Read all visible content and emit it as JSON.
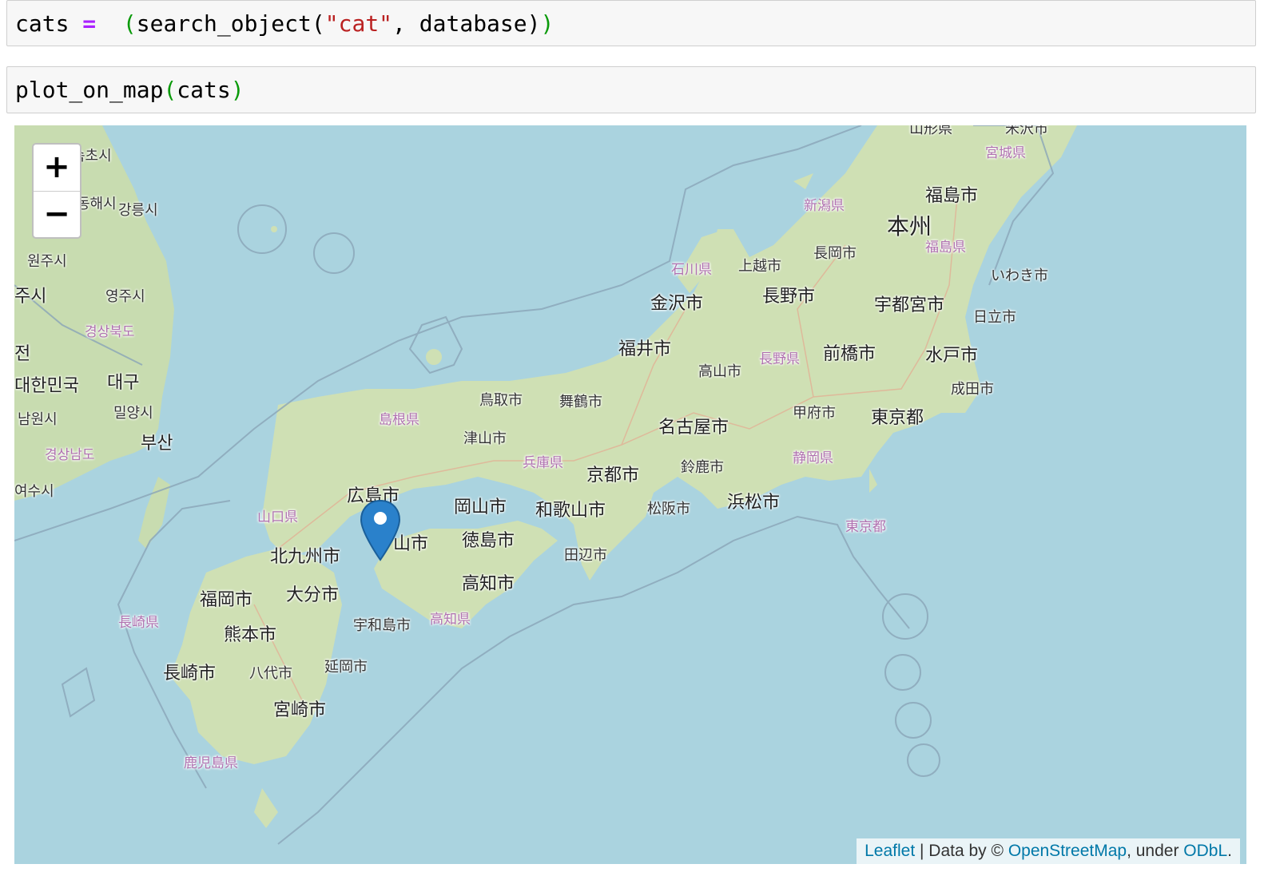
{
  "cells": [
    {
      "code": {
        "var": "cats",
        "op": "=",
        "open": "(",
        "func": "search_object(",
        "str": "\"cat\"",
        "rest": ", database)",
        "close": ")"
      }
    },
    {
      "code": {
        "func": "plot_on_map",
        "open": "(",
        "arg": "cats",
        "close": ")"
      }
    }
  ],
  "map": {
    "zoom_in_label": "+",
    "zoom_out_label": "−",
    "marker_icon": "map-marker-icon",
    "attribution": {
      "leaflet": "Leaflet",
      "sep": " | Data by © ",
      "osm": "OpenStreetMap",
      "under": ", under ",
      "odbl": "ODbL",
      "end": "."
    },
    "labels": {
      "yamagata": "山形県",
      "yonezawa": "米沢市",
      "miyagi": "宮城県",
      "sokcho": "속초시",
      "gangneung": "강릉시",
      "donghae": "동해시",
      "niigata_pref": "新潟県",
      "fukushima_city": "福島市",
      "honshu": "本州",
      "fukushima_pref": "福島県",
      "wonju": "원주시",
      "nagaoka": "長岡市",
      "ishikawa": "石川県",
      "joetsu": "上越市",
      "iwaki": "いわき市",
      "yeongju": "영주시",
      "chungju": "주시",
      "kanazawa": "金沢市",
      "nagano_city": "長野市",
      "utsunomiya": "宇都宮市",
      "hitachi": "日立市",
      "gyeongbuk": "경상북도",
      "jeon": "전",
      "fukui": "福井市",
      "maebashi": "前橋市",
      "mito": "水戸市",
      "nagano_pref": "長野県",
      "takayama": "高山市",
      "daegu": "대구",
      "korea": "대한민국",
      "narita": "成田市",
      "tottori": "鳥取市",
      "maizuru": "舞鶴市",
      "miryang": "밀양시",
      "shimane": "島根県",
      "kofu": "甲府市",
      "tokyo": "東京都",
      "namwon": "남원시",
      "busan": "부산",
      "nagoya": "名古屋市",
      "tsuyama": "津山市",
      "gyeongnam": "경상남도",
      "hyogo": "兵庫県",
      "suzuka": "鈴鹿市",
      "shizuoka_pref": "静岡県",
      "kyoto": "京都市",
      "yeosu": "여수시",
      "hiroshima": "広島市",
      "okayama": "岡山市",
      "wakayama": "和歌山市",
      "matsusaka": "松阪市",
      "hamamatsu": "浜松市",
      "yamaguchi": "山口県",
      "tokyo_islands": "東京都",
      "matsuyama": "山市",
      "tokushima": "徳島市",
      "kitakyushu": "北九州市",
      "tanabe": "田辺市",
      "kochi_city": "高知市",
      "fukuoka": "福岡市",
      "oita": "大分市",
      "nagasaki_pref": "長崎県",
      "uwajima": "宇和島市",
      "kochi_pref": "高知県",
      "kumamoto": "熊本市",
      "nagasaki": "長崎市",
      "yatsushiro": "八代市",
      "nobeoka": "延岡市",
      "miyazaki": "宮崎市",
      "kagoshima": "鹿児島県"
    }
  }
}
